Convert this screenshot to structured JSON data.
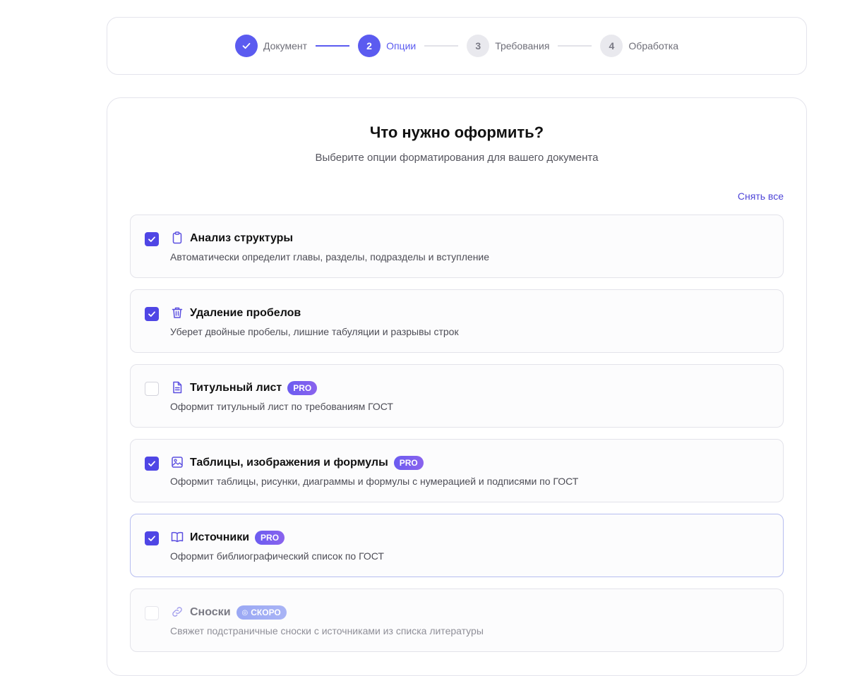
{
  "stepper": {
    "steps": [
      {
        "number": "✓",
        "label": "Документ",
        "state": "done"
      },
      {
        "number": "2",
        "label": "Опции",
        "state": "active"
      },
      {
        "number": "3",
        "label": "Требования",
        "state": "todo"
      },
      {
        "number": "4",
        "label": "Обработка",
        "state": "todo"
      }
    ]
  },
  "main": {
    "title": "Что нужно оформить?",
    "subtitle": "Выберите опции форматирования для вашего документа",
    "deselect_all": "Снять все",
    "options": [
      {
        "icon": "clipboard-icon",
        "title": "Анализ структуры",
        "description": "Автоматически определит главы, разделы, подразделы и вступление",
        "checked": true,
        "badge": ""
      },
      {
        "icon": "trash-icon",
        "title": "Удаление пробелов",
        "description": "Уберет двойные пробелы, лишние табуляции и разрывы строк",
        "checked": true,
        "badge": ""
      },
      {
        "icon": "document-icon",
        "title": "Титульный лист",
        "description": "Оформит титульный лист по требованиям ГОСТ",
        "checked": false,
        "badge": "PRO"
      },
      {
        "icon": "image-icon",
        "title": "Таблицы, изображения и формулы",
        "description": "Оформит таблицы, рисунки, диаграммы и формулы с нумерацией и подписями по ГОСТ",
        "checked": true,
        "badge": "PRO"
      },
      {
        "icon": "book-icon",
        "title": "Источники",
        "description": "Оформит библиографический список по ГОСТ",
        "checked": true,
        "badge": "PRO"
      },
      {
        "icon": "link-icon",
        "title": "Сноски",
        "description": "Свяжет подстраничные сноски с источниками из списка литературы",
        "checked": false,
        "badge": "СКОРО",
        "disabled": true
      }
    ]
  },
  "colors": {
    "accent": "#5b5bf0",
    "checkbox": "#4f46e5",
    "pro_badge": "#7560ef",
    "soon_badge": "#a1aef5"
  }
}
